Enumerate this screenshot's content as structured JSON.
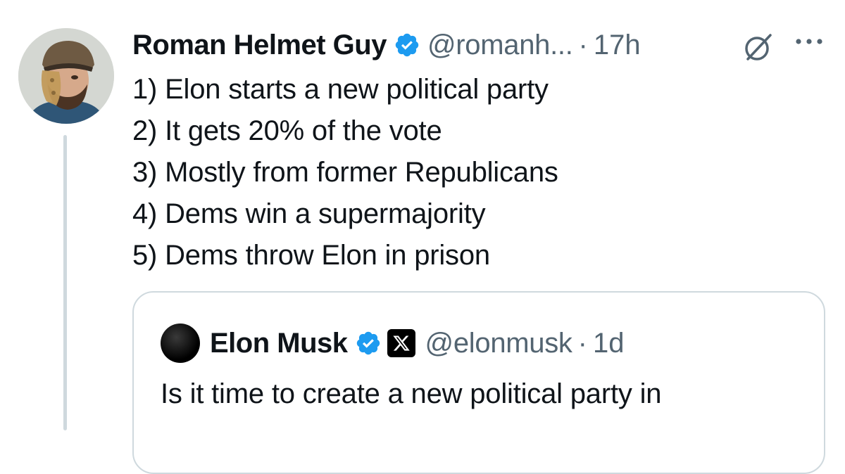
{
  "tweet": {
    "author_name": "Roman Helmet Guy",
    "handle": "@romanh...",
    "separator": "·",
    "time": "17h",
    "lines": [
      "1) Elon starts a new political party",
      "2) It gets 20% of the vote",
      "3) Mostly from former Republicans",
      "4) Dems win a supermajority",
      "5) Dems throw Elon in prison"
    ]
  },
  "quoted_tweet": {
    "author_name": "Elon Musk",
    "handle": "@elonmusk",
    "separator": "·",
    "time": "1d",
    "text": "Is it time to create a new political party in"
  },
  "icons": {
    "verified": "verified-badge-icon",
    "grok": "grok-icon",
    "more": "more-options-icon",
    "x_affiliation": "x-logo-icon"
  },
  "colors": {
    "verified_blue": "#1d9bf0",
    "secondary_text": "#536471",
    "border": "#cfd9de"
  }
}
